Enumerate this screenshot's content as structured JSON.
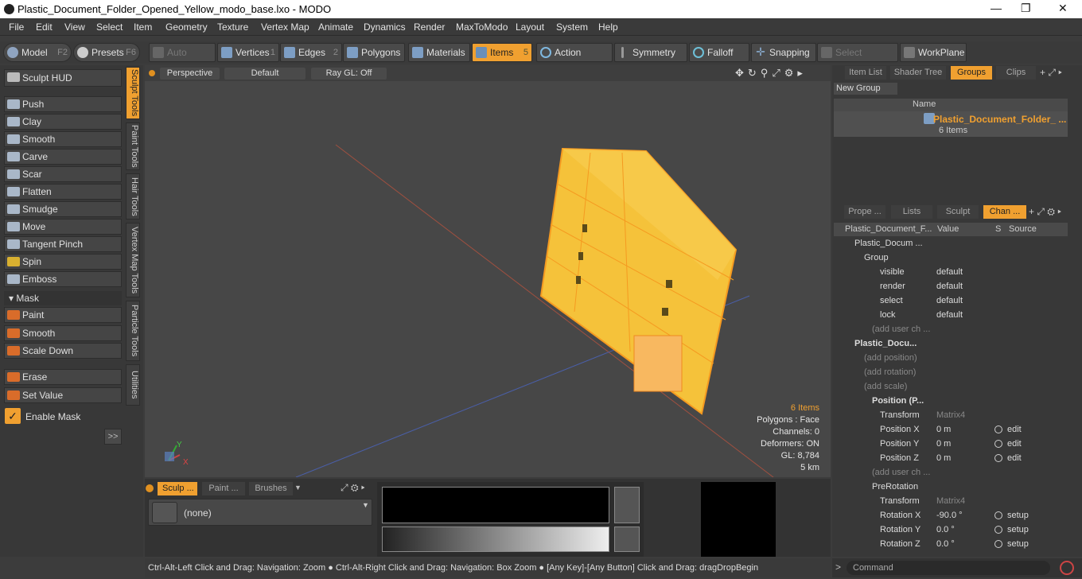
{
  "title": "Plastic_Document_Folder_Opened_Yellow_modo_base.lxo - MODO",
  "window_controls": {
    "min": "—",
    "max": "❐",
    "close": "✕"
  },
  "menu": [
    "File",
    "Edit",
    "View",
    "Select",
    "Item",
    "Geometry",
    "Texture",
    "Vertex Map",
    "Animate",
    "Dynamics",
    "Render",
    "MaxToModo",
    "Layout",
    "System",
    "Help"
  ],
  "toolbar": {
    "model": "Model",
    "model_key": "F2",
    "presets": "Presets",
    "presets_key": "F6",
    "auto_select": "Auto Select",
    "vertices": "Vertices",
    "vertices_key": "1",
    "edges": "Edges",
    "edges_key": "2",
    "polygons": "Polygons",
    "materials": "Materials",
    "items": "Items",
    "items_key": "5",
    "action_center": "Action Center",
    "symmetry": "Symmetry",
    "falloff": "Falloff",
    "snapping": "Snapping",
    "select_through": "Select Through",
    "workplane": "WorkPlane"
  },
  "left": {
    "sculpt_hud": "Sculpt HUD",
    "tools": [
      "Push",
      "Clay",
      "Smooth",
      "Carve",
      "Scar",
      "Flatten",
      "Smudge",
      "Move",
      "Tangent Pinch",
      "Spin",
      "Emboss"
    ],
    "mask_header": "Mask",
    "mask_tools": [
      "Paint",
      "Smooth",
      "Scale Down"
    ],
    "erase": "Erase",
    "set_value": "Set Value",
    "enable_mask": "Enable Mask",
    "more": ">>",
    "vtabs": [
      "Sculpt Tools",
      "Paint Tools",
      "Hair Tools",
      "Vertex Map Tools",
      "Particle Tools",
      "Utilities"
    ]
  },
  "viewport": {
    "view": "Perspective",
    "shading": "Default",
    "raygl": "Ray GL: Off",
    "stats": {
      "items": "6 Items",
      "polygons": "Polygons : Face",
      "channels": "Channels: 0",
      "deformers": "Deformers: ON",
      "gl": "GL: 8,784",
      "scale": "5 km"
    },
    "axis_y": "Y",
    "axis_x": "X"
  },
  "bottom": {
    "tabs": [
      "Sculp ...",
      "Paint ...",
      "Brushes"
    ],
    "brush": "(none)"
  },
  "status": "Ctrl-Alt-Left Click and Drag: Navigation: Zoom ● Ctrl-Alt-Right Click and Drag: Navigation: Box Zoom ● [Any Key]-[Any Button] Click and Drag: dragDropBegin",
  "right": {
    "tabs1": [
      "Item List",
      "Shader Tree",
      "Groups",
      "Clips"
    ],
    "new_group": "New Group",
    "name_col": "Name",
    "group_name": "Plastic_Document_Folder_ ...",
    "group_count": "6 Items",
    "tabs2": [
      "Prope ...",
      "Lists",
      "Sculpt",
      "Chan ..."
    ],
    "cols": {
      "name": "Plastic_Document_F...",
      "value": "Value",
      "s": "S",
      "source": "Source"
    },
    "rows": [
      {
        "n": "Plastic_Docum ...",
        "v": "",
        "src": ""
      },
      {
        "n": "Group",
        "v": "",
        "src": ""
      },
      {
        "n": "visible",
        "v": "default",
        "src": ""
      },
      {
        "n": "render",
        "v": "default",
        "src": ""
      },
      {
        "n": "select",
        "v": "default",
        "src": ""
      },
      {
        "n": "lock",
        "v": "default",
        "src": ""
      },
      {
        "n": "(add user ch ...",
        "v": "",
        "src": ""
      },
      {
        "n": "Plastic_Docu...",
        "v": "",
        "src": ""
      },
      {
        "n": "(add position)",
        "v": "",
        "src": ""
      },
      {
        "n": "(add rotation)",
        "v": "",
        "src": ""
      },
      {
        "n": "(add scale)",
        "v": "",
        "src": ""
      },
      {
        "n": "Position (P...",
        "v": "",
        "src": ""
      },
      {
        "n": "Transform",
        "v": "Matrix4",
        "src": ""
      },
      {
        "n": "Position X",
        "v": "0 m",
        "src": "edit"
      },
      {
        "n": "Position Y",
        "v": "0 m",
        "src": "edit"
      },
      {
        "n": "Position Z",
        "v": "0 m",
        "src": "edit"
      },
      {
        "n": "(add user ch ...",
        "v": "",
        "src": ""
      },
      {
        "n": "PreRotation",
        "v": "",
        "src": ""
      },
      {
        "n": "Transform",
        "v": "Matrix4",
        "src": ""
      },
      {
        "n": "Rotation X",
        "v": "-90.0 °",
        "src": "setup"
      },
      {
        "n": "Rotation Y",
        "v": "0.0 °",
        "src": "setup"
      },
      {
        "n": "Rotation Z",
        "v": "0.0 °",
        "src": "setup"
      }
    ],
    "command": "Command"
  }
}
